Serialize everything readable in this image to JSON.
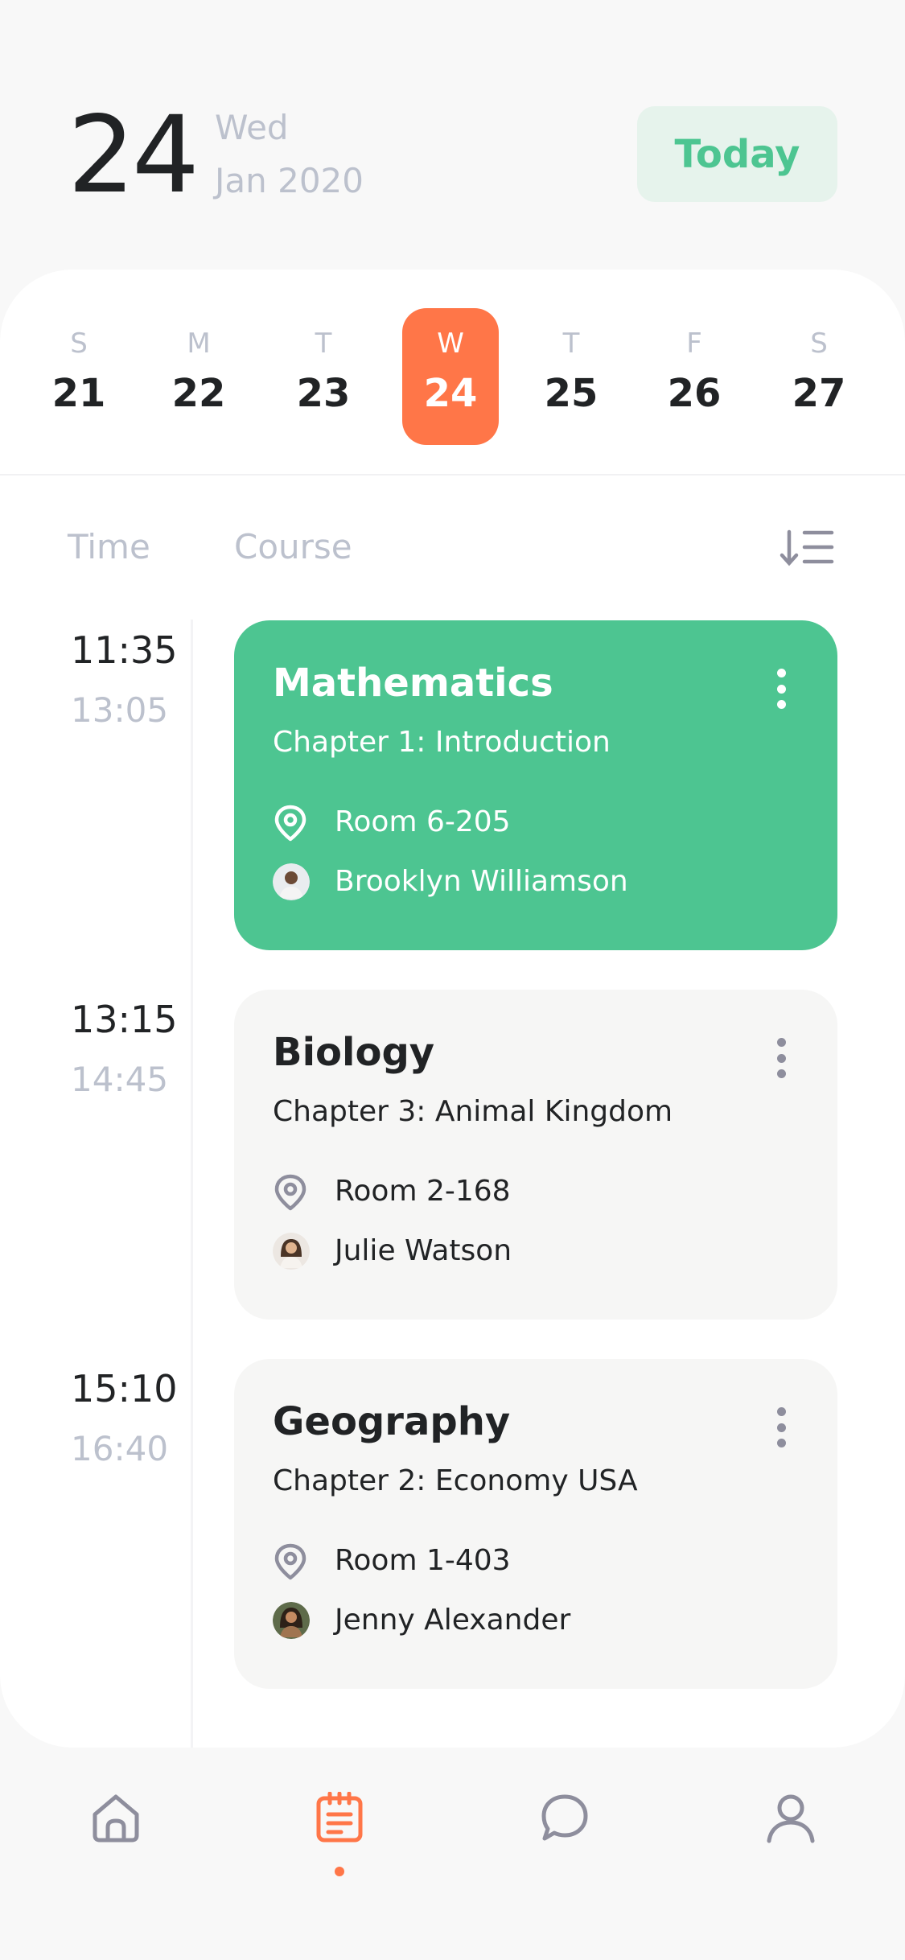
{
  "header": {
    "day_number": "24",
    "weekday": "Wed",
    "month_year": "Jan 2020",
    "today_label": "Today"
  },
  "week": [
    {
      "letter": "S",
      "number": "21",
      "selected": false
    },
    {
      "letter": "M",
      "number": "22",
      "selected": false
    },
    {
      "letter": "T",
      "number": "23",
      "selected": false
    },
    {
      "letter": "W",
      "number": "24",
      "selected": true
    },
    {
      "letter": "T",
      "number": "25",
      "selected": false
    },
    {
      "letter": "F",
      "number": "26",
      "selected": false
    },
    {
      "letter": "S",
      "number": "27",
      "selected": false
    }
  ],
  "columns": {
    "time": "Time",
    "course": "Course"
  },
  "schedule": [
    {
      "start": "11:35",
      "end": "13:05",
      "title": "Mathematics",
      "subtitle": "Chapter 1: Introduction",
      "room": "Room 6-205",
      "teacher": "Brooklyn Williamson",
      "active": true
    },
    {
      "start": "13:15",
      "end": "14:45",
      "title": "Biology",
      "subtitle": "Chapter 3: Animal Kingdom",
      "room": "Room 2-168",
      "teacher": "Julie Watson",
      "active": false
    },
    {
      "start": "15:10",
      "end": "16:40",
      "title": "Geography",
      "subtitle": "Chapter 2: Economy USA",
      "room": "Room 1-403",
      "teacher": "Jenny Alexander",
      "active": false
    }
  ],
  "nav": {
    "items": [
      "home-icon",
      "schedule-icon",
      "chat-icon",
      "profile-icon"
    ],
    "active": "schedule-icon"
  },
  "colors": {
    "accent": "#ff7648",
    "green": "#4dc591",
    "today_bg": "#e6f3ec",
    "muted": "#bcc1cd",
    "text": "#212325"
  }
}
